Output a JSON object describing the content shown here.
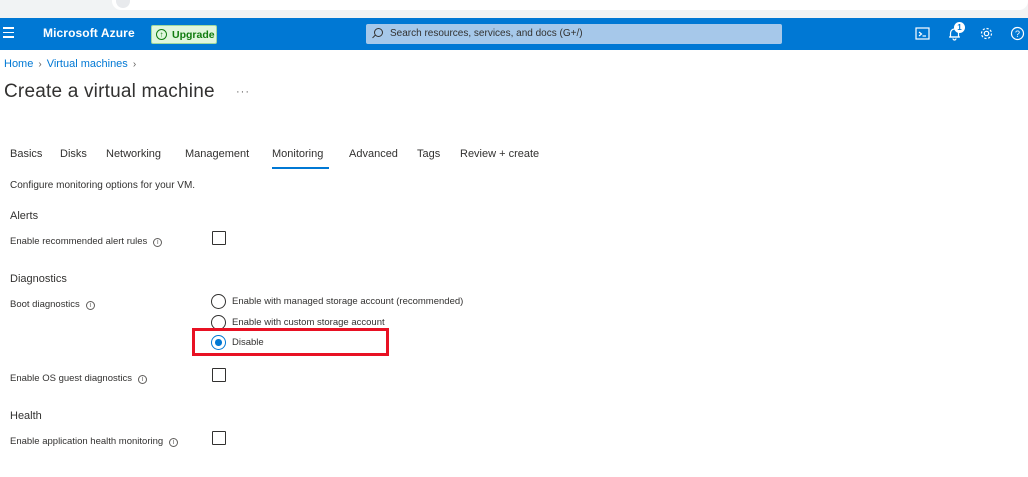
{
  "header": {
    "brand": "Microsoft Azure",
    "upgrade_label": "Upgrade",
    "search_placeholder": "Search resources, services, and docs (G+/)",
    "notification_count": "1",
    "accent_color": "#0078d4"
  },
  "breadcrumb": {
    "items": [
      "Home",
      "Virtual machines"
    ]
  },
  "page": {
    "title": "Create a virtual machine",
    "more_label": "···"
  },
  "tabs": [
    {
      "label": "Basics"
    },
    {
      "label": "Disks"
    },
    {
      "label": "Networking"
    },
    {
      "label": "Management"
    },
    {
      "label": "Monitoring",
      "active": true
    },
    {
      "label": "Advanced"
    },
    {
      "label": "Tags"
    },
    {
      "label": "Review + create"
    }
  ],
  "monitoring": {
    "description": "Configure monitoring options for your VM.",
    "alerts": {
      "heading": "Alerts",
      "recommended_alert_rules_label": "Enable recommended alert rules",
      "recommended_alert_rules_checked": false
    },
    "diagnostics": {
      "heading": "Diagnostics",
      "boot_label": "Boot diagnostics",
      "boot_options": [
        "Enable with managed storage account (recommended)",
        "Enable with custom storage account",
        "Disable"
      ],
      "boot_selected": "Disable",
      "os_guest_label": "Enable OS guest diagnostics",
      "os_guest_checked": false
    },
    "health": {
      "heading": "Health",
      "app_health_label": "Enable application health monitoring",
      "app_health_checked": false
    }
  },
  "icons": {
    "info": "i"
  }
}
